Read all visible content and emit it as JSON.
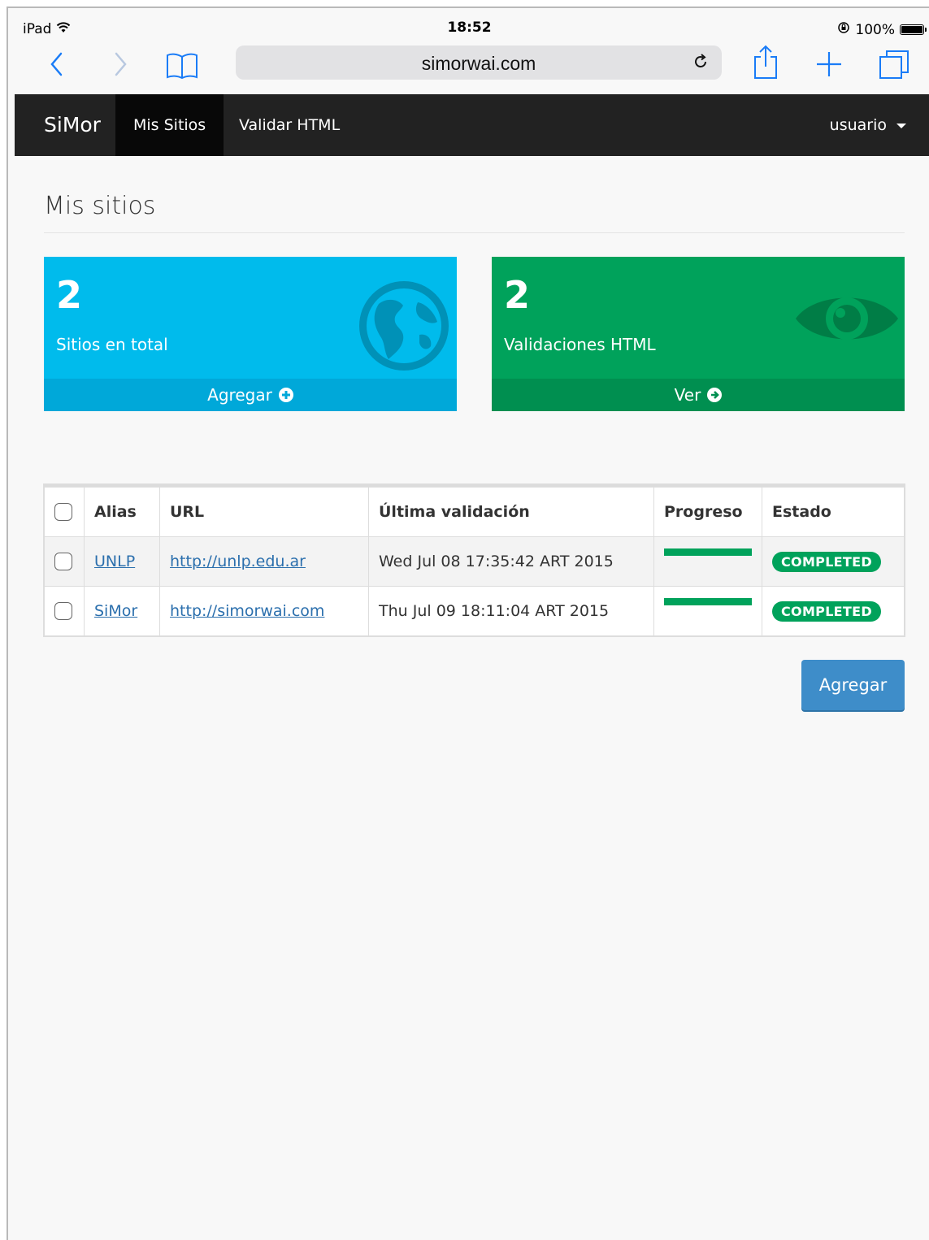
{
  "status_bar": {
    "device": "iPad",
    "time": "18:52",
    "battery": "100%"
  },
  "browser": {
    "url": "simorwai.com"
  },
  "navbar": {
    "brand": "SiMor",
    "items": [
      {
        "label": "Mis Sitios",
        "active": true
      },
      {
        "label": "Validar HTML",
        "active": false
      }
    ],
    "user": "usuario"
  },
  "page": {
    "title": "Mis sitios"
  },
  "cards": [
    {
      "number": "2",
      "label": "Sitios en total",
      "action": "Agregar",
      "icon": "globe-icon",
      "color": "#00bbec"
    },
    {
      "number": "2",
      "label": "Validaciones HTML",
      "action": "Ver",
      "icon": "eye-icon",
      "color": "#00a25b"
    }
  ],
  "table": {
    "headers": [
      "Alias",
      "URL",
      "Última validación",
      "Progreso",
      "Estado"
    ],
    "rows": [
      {
        "alias": "UNLP",
        "url": "http://unlp.edu.ar",
        "last": "Wed Jul 08 17:35:42 ART 2015",
        "progress": 1.0,
        "status": "COMPLETED"
      },
      {
        "alias": "SiMor",
        "url": "http://simorwai.com",
        "last": "Thu Jul 09 18:11:04 ART 2015",
        "progress": 1.0,
        "status": "COMPLETED"
      }
    ]
  },
  "add_button": "Agregar"
}
